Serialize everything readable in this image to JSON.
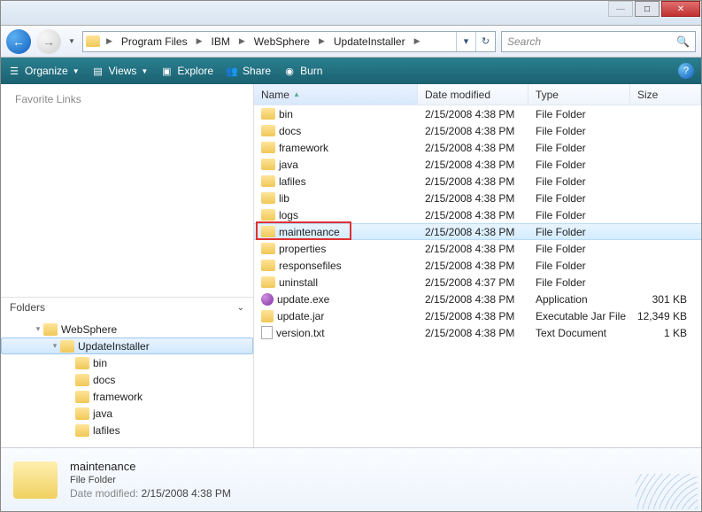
{
  "window": {
    "breadcrumb": [
      "Program Files",
      "IBM",
      "WebSphere",
      "UpdateInstaller"
    ],
    "search_placeholder": "Search"
  },
  "toolbar": {
    "organize": "Organize",
    "views": "Views",
    "explore": "Explore",
    "share": "Share",
    "burn": "Burn"
  },
  "sidebar": {
    "favorites_title": "Favorite Links",
    "folders_title": "Folders",
    "tree": [
      {
        "label": "WebSphere",
        "depth": 1,
        "expanded": true
      },
      {
        "label": "UpdateInstaller",
        "depth": 2,
        "expanded": true,
        "selected": true
      },
      {
        "label": "bin",
        "depth": 3
      },
      {
        "label": "docs",
        "depth": 3
      },
      {
        "label": "framework",
        "depth": 3
      },
      {
        "label": "java",
        "depth": 3
      },
      {
        "label": "lafiles",
        "depth": 3
      }
    ]
  },
  "columns": {
    "name": "Name",
    "date": "Date modified",
    "type": "Type",
    "size": "Size"
  },
  "files": [
    {
      "name": "bin",
      "date": "2/15/2008 4:38 PM",
      "type": "File Folder",
      "size": "",
      "icon": "folder"
    },
    {
      "name": "docs",
      "date": "2/15/2008 4:38 PM",
      "type": "File Folder",
      "size": "",
      "icon": "folder"
    },
    {
      "name": "framework",
      "date": "2/15/2008 4:38 PM",
      "type": "File Folder",
      "size": "",
      "icon": "folder"
    },
    {
      "name": "java",
      "date": "2/15/2008 4:38 PM",
      "type": "File Folder",
      "size": "",
      "icon": "folder"
    },
    {
      "name": "lafiles",
      "date": "2/15/2008 4:38 PM",
      "type": "File Folder",
      "size": "",
      "icon": "folder"
    },
    {
      "name": "lib",
      "date": "2/15/2008 4:38 PM",
      "type": "File Folder",
      "size": "",
      "icon": "folder"
    },
    {
      "name": "logs",
      "date": "2/15/2008 4:38 PM",
      "type": "File Folder",
      "size": "",
      "icon": "folder"
    },
    {
      "name": "maintenance",
      "date": "2/15/2008 4:38 PM",
      "type": "File Folder",
      "size": "",
      "icon": "folder",
      "selected": true,
      "highlighted": true
    },
    {
      "name": "properties",
      "date": "2/15/2008 4:38 PM",
      "type": "File Folder",
      "size": "",
      "icon": "folder"
    },
    {
      "name": "responsefiles",
      "date": "2/15/2008 4:38 PM",
      "type": "File Folder",
      "size": "",
      "icon": "folder"
    },
    {
      "name": "uninstall",
      "date": "2/15/2008 4:37 PM",
      "type": "File Folder",
      "size": "",
      "icon": "folder"
    },
    {
      "name": "update.exe",
      "date": "2/15/2008 4:38 PM",
      "type": "Application",
      "size": "301 KB",
      "icon": "exe"
    },
    {
      "name": "update.jar",
      "date": "2/15/2008 4:38 PM",
      "type": "Executable Jar File",
      "size": "12,349 KB",
      "icon": "jar"
    },
    {
      "name": "version.txt",
      "date": "2/15/2008 4:38 PM",
      "type": "Text Document",
      "size": "1 KB",
      "icon": "txt"
    }
  ],
  "details": {
    "name": "maintenance",
    "type": "File Folder",
    "modified_label": "Date modified:",
    "modified_value": "2/15/2008 4:38 PM"
  }
}
